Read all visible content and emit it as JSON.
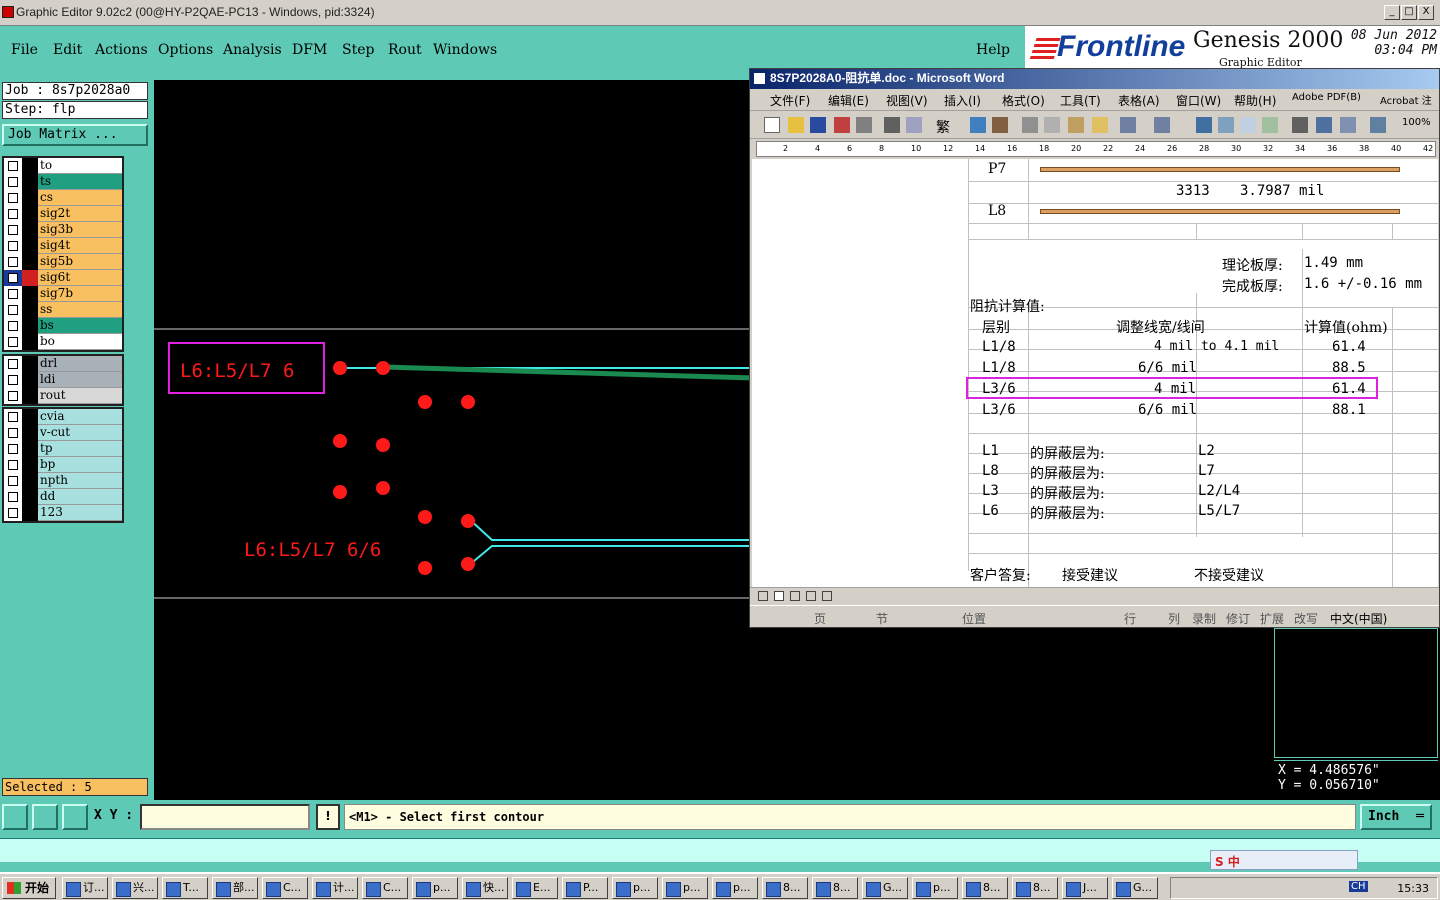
{
  "window": {
    "title": "Graphic Editor 9.02c2 (00@HY-P2QAE-PC13 - Windows, pid:3324)",
    "buttons": [
      "_",
      "□",
      "X"
    ]
  },
  "menu": {
    "items": [
      "File",
      "Edit",
      "Actions",
      "Options",
      "Analysis",
      "DFM",
      "Step",
      "Rout",
      "Windows"
    ],
    "help": "Help"
  },
  "brand": {
    "logo": "Frontline",
    "product": "Genesis 2000",
    "subtitle": "Graphic Editor",
    "date": "08 Jun 2012",
    "time": "03:04 PM",
    "colors": {
      "logo": "#123f9c",
      "stripes": "#e02020"
    }
  },
  "job": {
    "job_label": "Job : 8s7p2028a0",
    "step_label": "Step: flp",
    "matrix_button": "Job Matrix ...",
    "selected": "Selected : 5"
  },
  "layers": {
    "group1": [
      {
        "name": "to",
        "color": "#ffffff"
      },
      {
        "name": "ts",
        "color": "#20a080"
      },
      {
        "name": "cs",
        "color": "#f8c060"
      },
      {
        "name": "sig2t",
        "color": "#f8c060"
      },
      {
        "name": "sig3b",
        "color": "#f8c060"
      },
      {
        "name": "sig4t",
        "color": "#f8c060"
      },
      {
        "name": "sig5b",
        "color": "#f8c060"
      },
      {
        "name": "sig6t",
        "color": "#f8c060",
        "active": true
      },
      {
        "name": "sig7b",
        "color": "#f8c060"
      },
      {
        "name": "ss",
        "color": "#f8c060"
      },
      {
        "name": "bs",
        "color": "#20a080"
      },
      {
        "name": "bo",
        "color": "#ffffff"
      }
    ],
    "group2": [
      {
        "name": "drl",
        "color": "#a8b0b8"
      },
      {
        "name": "ldi",
        "color": "#a8b0b8"
      },
      {
        "name": "rout",
        "color": "#d8d8d8"
      }
    ],
    "group3": [
      {
        "name": "cvia",
        "color": "#a8e0e0"
      },
      {
        "name": "v-cut",
        "color": "#a8e0e0"
      },
      {
        "name": "tp",
        "color": "#a8e0e0"
      },
      {
        "name": "bp",
        "color": "#a8e0e0"
      },
      {
        "name": "npth",
        "color": "#a8e0e0"
      },
      {
        "name": "dd",
        "color": "#a8e0e0"
      },
      {
        "name": "123",
        "color": "#a8e0e0"
      }
    ]
  },
  "canvas": {
    "label1": "L6:L5/L7 6",
    "label2": "L6:L5/L7 6/6",
    "colors": {
      "pad": "#ff1a1a",
      "trace": "#40e8e8",
      "selected_trace": "#1a8a50",
      "label": "#ff1a1a",
      "box": "#e020e0"
    }
  },
  "word": {
    "title": "8S7P2028A0-阻抗单.doc - Microsoft Word",
    "menu": [
      "文件(F)",
      "编辑(E)",
      "视图(V)",
      "插入(I)",
      "格式(O)",
      "工具(T)",
      "表格(A)",
      "窗口(W)",
      "帮助(H)",
      "Adobe PDF(B)",
      "Acrobat 注"
    ],
    "toolbar_text": {
      "trad": "繁",
      "zoom": "100%"
    },
    "ruler": [
      "2",
      "4",
      "6",
      "8",
      "10",
      "12",
      "14",
      "16",
      "18",
      "20",
      "22",
      "24",
      "26",
      "28",
      "30",
      "32",
      "34",
      "36",
      "38",
      "40",
      "42"
    ],
    "doc": {
      "p7": "P7",
      "l8": "L8",
      "thickness_row": [
        "3313",
        "3.7987 mil"
      ],
      "theory_label": "理论板厚:",
      "theory_value": "1.49 mm",
      "finish_label": "完成板厚:",
      "finish_value": "1.6 +/-0.16 mm",
      "calc_title": "阻抗计算值:",
      "headers": [
        "层别",
        "调整线宽/线间",
        "计算值(ohm)"
      ],
      "rows": [
        [
          "L1/8",
          "4 mil to 4.1 mil",
          "61.4"
        ],
        [
          "L1/8",
          "6/6 mil",
          "88.5"
        ],
        [
          "L3/6",
          "4 mil",
          "61.4"
        ],
        [
          "L3/6",
          "6/6 mil",
          "88.1"
        ]
      ],
      "shield_rows": [
        [
          "L1",
          "的屏蔽层为:",
          "L2"
        ],
        [
          "L8",
          "的屏蔽层为:",
          "L7"
        ],
        [
          "L3",
          "的屏蔽层为:",
          "L2/L4"
        ],
        [
          "L6",
          "的屏蔽层为:",
          "L5/L7"
        ]
      ],
      "reply_label": "客户答复:",
      "accept": "接受建议",
      "reject": "不接受建议"
    },
    "status": [
      "页",
      "节",
      "位置",
      "行",
      "列",
      "录制",
      "修订",
      "扩展",
      "改写",
      "中文(中国)"
    ]
  },
  "coords": {
    "x": "X = 4.486576\"",
    "y": "Y = 0.056710\""
  },
  "command": {
    "xy_label": "X Y :",
    "xy_value": "",
    "excl": "!",
    "prompt": "<M1> - Select first contour",
    "unit": "Inch"
  },
  "ime": {
    "label": "S 中"
  },
  "taskbar": {
    "start": "开始",
    "tasks": [
      "订...",
      "兴...",
      "T...",
      "部...",
      "C...",
      "计...",
      "C...",
      "p...",
      "快...",
      "E...",
      "P...",
      "p...",
      "p...",
      "p...",
      "8...",
      "8...",
      "G...",
      "p...",
      "8...",
      "8...",
      "J...",
      "G..."
    ],
    "tray": "CH",
    "clock": "15:33"
  }
}
